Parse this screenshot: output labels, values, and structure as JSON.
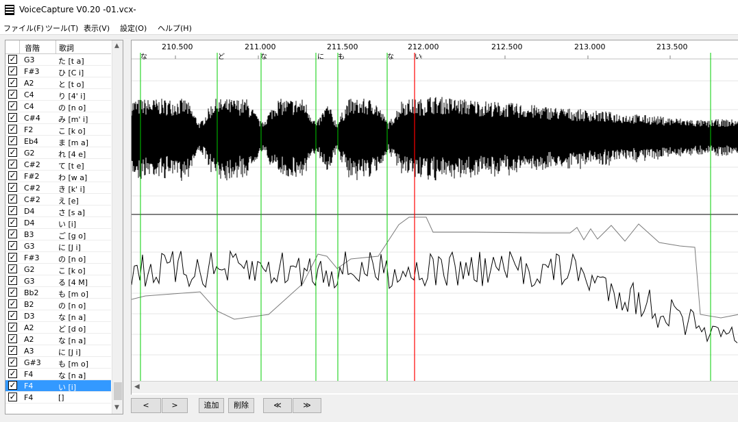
{
  "window": {
    "title": "VoiceCapture V0.20 -01.vcx-"
  },
  "menu": [
    "ファイル(F)",
    "ツール(T)",
    "表示(V)",
    "設定(O)",
    "ヘルプ(H)"
  ],
  "list": {
    "headers": [
      "音階",
      "歌詞"
    ],
    "rows": [
      {
        "note": "G3",
        "lyric": "た [t a]",
        "checked": true
      },
      {
        "note": "F#3",
        "lyric": "ひ [C i]",
        "checked": true
      },
      {
        "note": "A2",
        "lyric": "と [t o]",
        "checked": true
      },
      {
        "note": "C4",
        "lyric": "り [4' i]",
        "checked": true
      },
      {
        "note": "C4",
        "lyric": "の [n o]",
        "checked": true
      },
      {
        "note": "C#4",
        "lyric": "み [m' i]",
        "checked": true
      },
      {
        "note": "F2",
        "lyric": "こ [k o]",
        "checked": true
      },
      {
        "note": "Eb4",
        "lyric": "ま [m a]",
        "checked": true
      },
      {
        "note": "G2",
        "lyric": "れ [4 e]",
        "checked": true
      },
      {
        "note": "C#2",
        "lyric": "て [t e]",
        "checked": true
      },
      {
        "note": "F#2",
        "lyric": "わ [w a]",
        "checked": true
      },
      {
        "note": "C#2",
        "lyric": "き [k' i]",
        "checked": true
      },
      {
        "note": "C#2",
        "lyric": "え [e]",
        "checked": true
      },
      {
        "note": "D4",
        "lyric": "さ [s a]",
        "checked": true
      },
      {
        "note": "D4",
        "lyric": "い [i]",
        "checked": true
      },
      {
        "note": "B3",
        "lyric": "ご [g o]",
        "checked": true
      },
      {
        "note": "G3",
        "lyric": "に [J i]",
        "checked": true
      },
      {
        "note": "F#3",
        "lyric": "の [n o]",
        "checked": true
      },
      {
        "note": "G2",
        "lyric": "こ [k o]",
        "checked": true
      },
      {
        "note": "G3",
        "lyric": "る [4 M]",
        "checked": true
      },
      {
        "note": "Bb2",
        "lyric": "も [m o]",
        "checked": true
      },
      {
        "note": "B2",
        "lyric": "の [n o]",
        "checked": true
      },
      {
        "note": "D3",
        "lyric": "な [n a]",
        "checked": true
      },
      {
        "note": "A2",
        "lyric": "ど [d o]",
        "checked": true
      },
      {
        "note": "A2",
        "lyric": "な [n a]",
        "checked": true
      },
      {
        "note": "A3",
        "lyric": "に [J i]",
        "checked": true
      },
      {
        "note": "G#3",
        "lyric": "も [m o]",
        "checked": true
      },
      {
        "note": "F4",
        "lyric": "な [n a]",
        "checked": true
      },
      {
        "note": "F4",
        "lyric": "い [i]",
        "checked": true,
        "selected": true
      },
      {
        "note": "F4",
        "lyric": "[]",
        "checked": true
      }
    ]
  },
  "timeline": {
    "ticks": [
      "210.500",
      "211.000",
      "211.500",
      "212.000",
      "212.500",
      "213.000",
      "213.500"
    ],
    "lyric_marks": [
      "な",
      "ど",
      "な",
      "に",
      "も",
      "な",
      "い"
    ],
    "segment_color": "#00cc00",
    "cursor_color": "#ff0000"
  },
  "buttons": {
    "prev": "<",
    "next": ">",
    "add": "追加",
    "delete": "削除",
    "first": "≪",
    "last": "≫"
  }
}
